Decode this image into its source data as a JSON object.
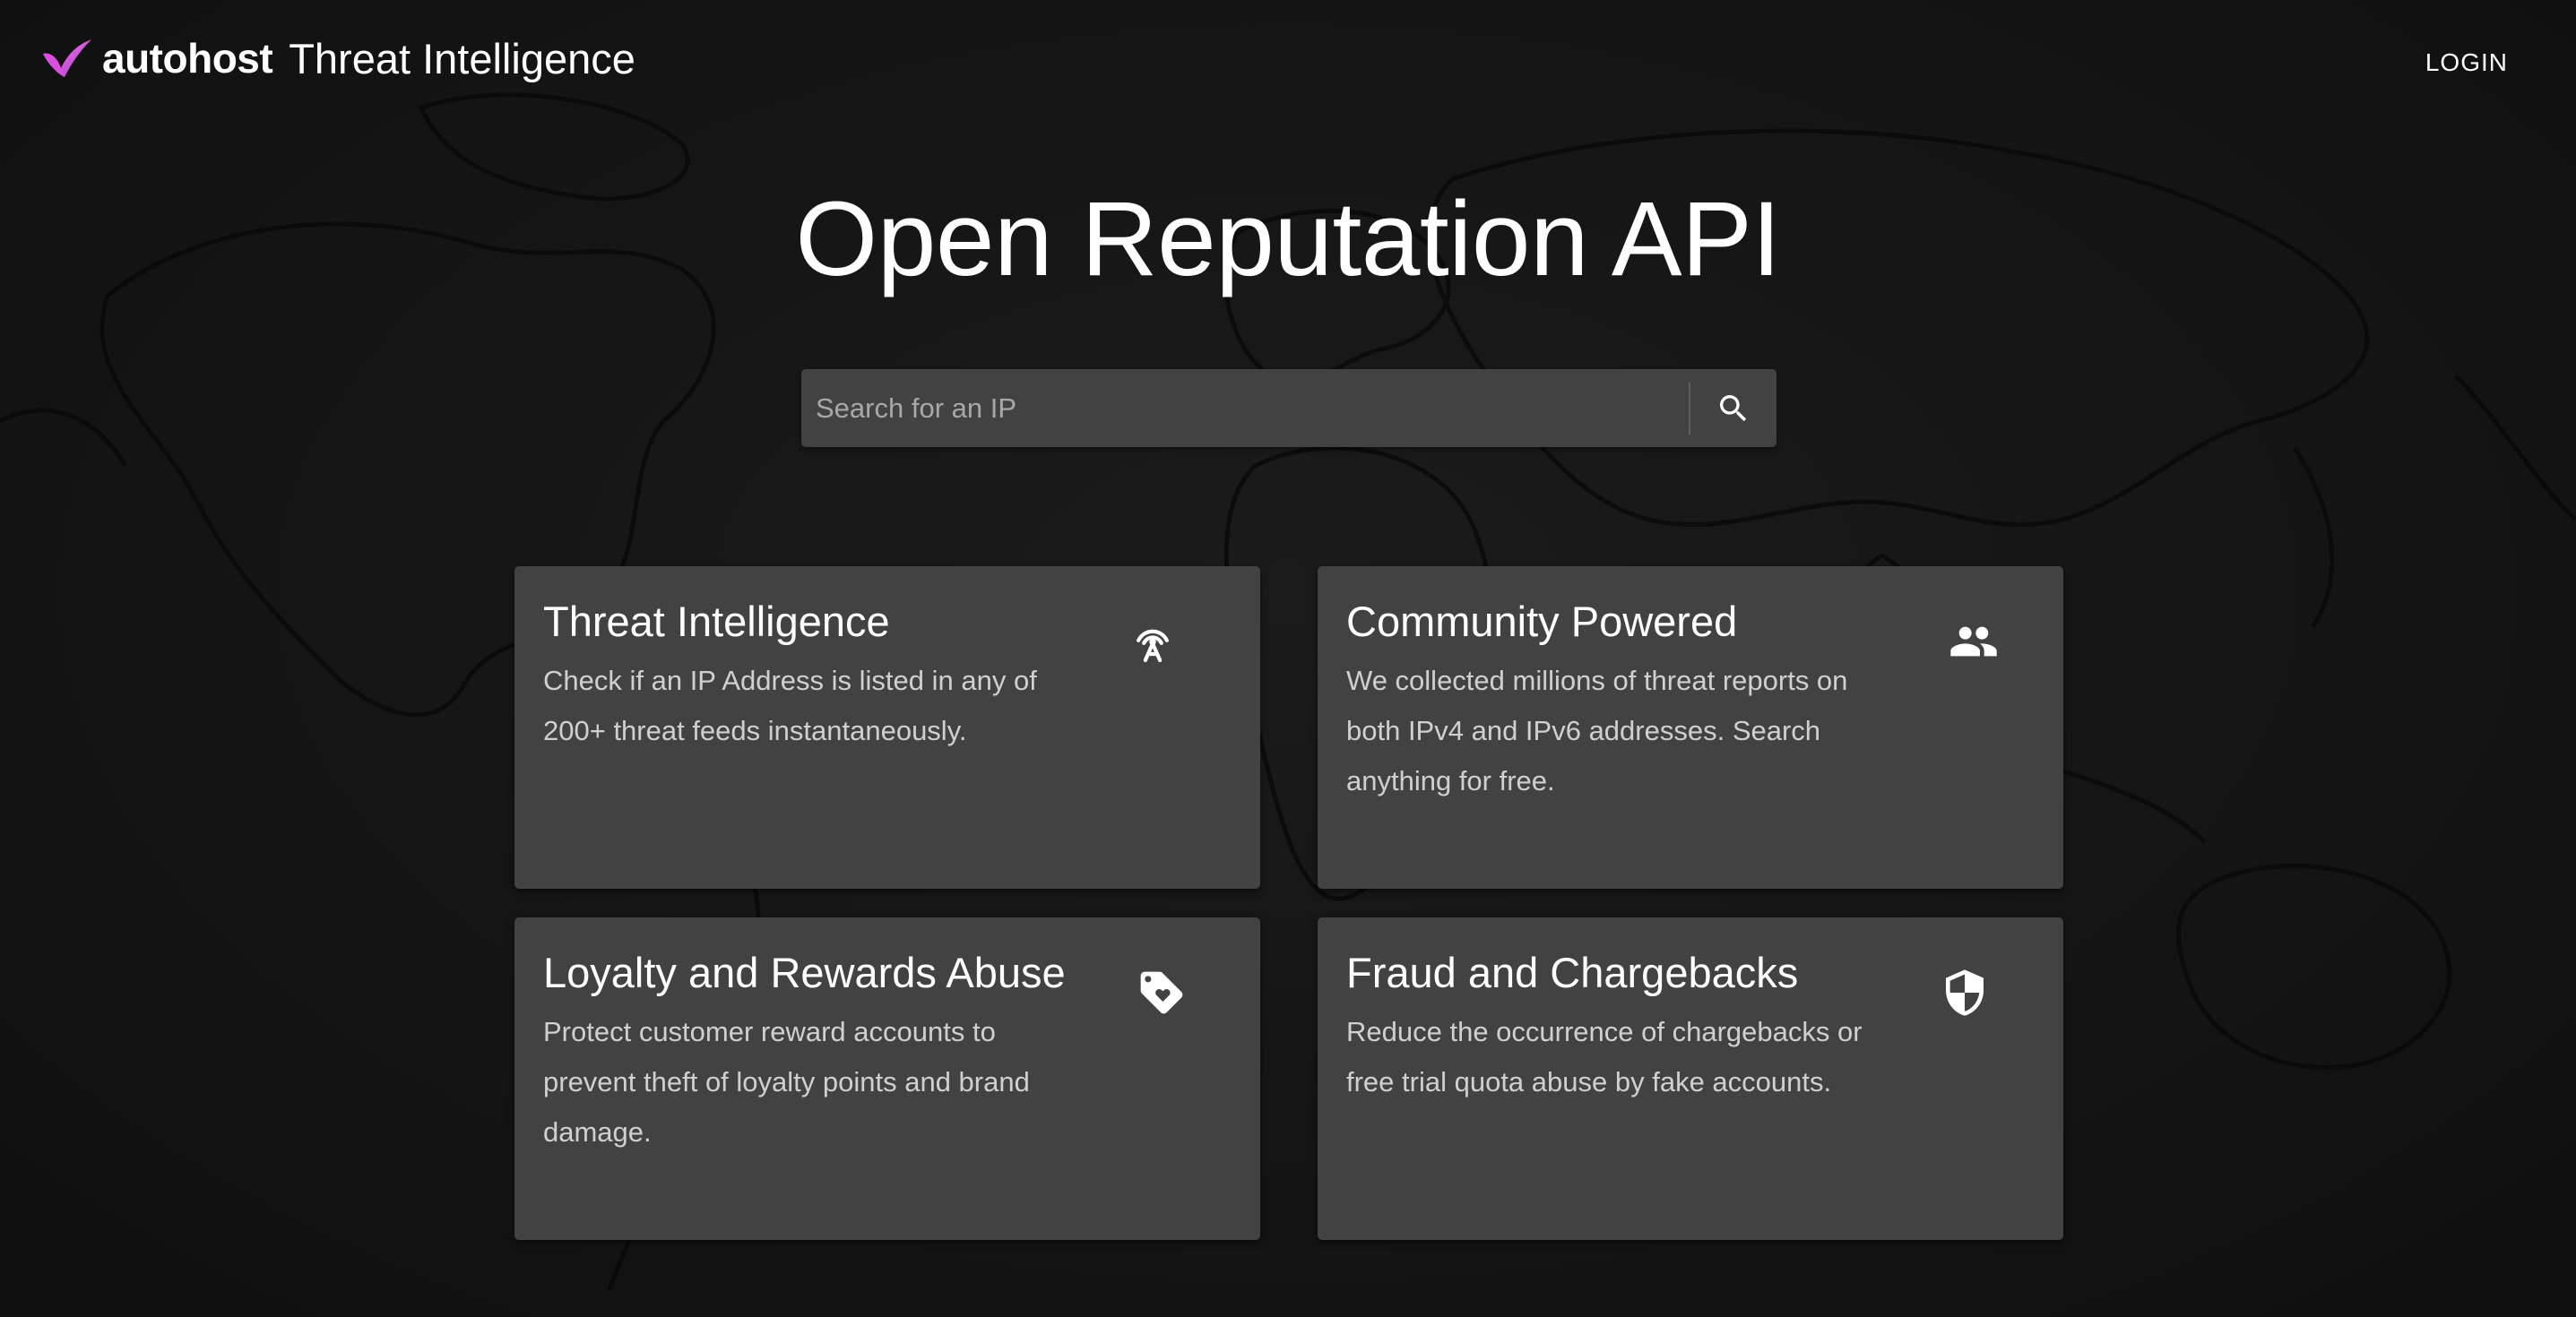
{
  "header": {
    "brand_name": "autohost",
    "product_name": "Threat Intelligence",
    "login_label": "LOGIN",
    "logo_icon": "autohost-check-logo",
    "accent_color": "#c94ae8"
  },
  "hero": {
    "title": "Open Reputation API"
  },
  "search": {
    "placeholder": "Search for an IP",
    "value": "",
    "button_icon": "search-icon"
  },
  "cards": [
    {
      "title": "Threat Intelligence",
      "description": "Check if an IP Address is listed in any of 200+ threat feeds instantaneously.",
      "icon": "antenna-icon"
    },
    {
      "title": "Community Powered",
      "description": "We collected millions of threat reports on both IPv4 and IPv6 addresses. Search anything for free.",
      "icon": "people-icon"
    },
    {
      "title": "Loyalty and Rewards Abuse",
      "description": "Protect customer reward accounts to prevent theft of loyalty points and brand damage.",
      "icon": "heart-tag-icon"
    },
    {
      "title": "Fraud and Chargebacks",
      "description": "Reduce the occurrence of chargebacks or free trial quota abuse by fake accounts.",
      "icon": "shield-icon"
    }
  ],
  "colors": {
    "background": "#141414",
    "card": "#424242",
    "text": "#ffffff",
    "muted_text": "#d0d0d0"
  }
}
